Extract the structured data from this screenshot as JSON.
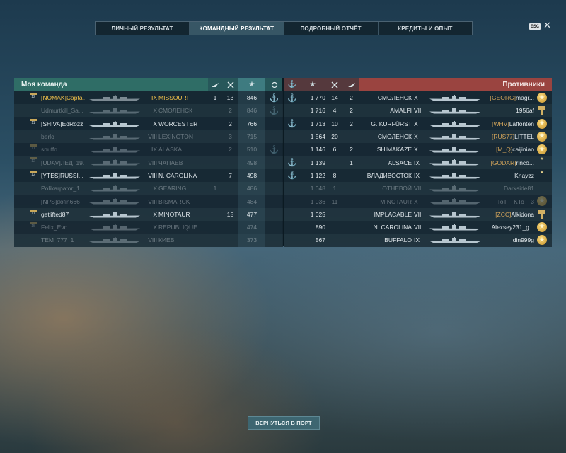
{
  "tabs": [
    {
      "label": "ЛИЧНЫЙ РЕЗУЛЬТАТ",
      "active": false
    },
    {
      "label": "КОМАНДНЫЙ РЕЗУЛЬТАТ",
      "active": true
    },
    {
      "label": "ПОДРОБНЫЙ ОТЧЁТ",
      "active": false
    },
    {
      "label": "КРЕДИТЫ И ОПЫТ",
      "active": false
    }
  ],
  "esc_key": "ESC",
  "close_glyph": "✕",
  "my_team": {
    "title": "Моя команда",
    "header_icons": [
      "planes-icon",
      "frags-icon",
      "star-icon",
      "rank-laurel-icon"
    ],
    "players": [
      {
        "rank_badge": "12",
        "clan": "[NOMAK]",
        "name": "Capta...",
        "tier": "IX",
        "ship": "MISSOURI",
        "planes": "1",
        "frags": "13",
        "xp": "846",
        "anchor": true,
        "alive": true,
        "me": true
      },
      {
        "rank_badge": "",
        "clan": "",
        "name": "Udmurtkill_Sa...",
        "tier": "X",
        "ship": "СМОЛЕНСК",
        "planes": "",
        "frags": "2",
        "xp": "846",
        "anchor": true,
        "alive": false,
        "me": false
      },
      {
        "rank_badge": "11",
        "clan": "[SHIVA]",
        "name": "EdRozz",
        "tier": "X",
        "ship": "WORCESTER",
        "planes": "",
        "frags": "2",
        "xp": "766",
        "anchor": false,
        "alive": true,
        "me": false
      },
      {
        "rank_badge": "",
        "clan": "",
        "name": "berlo",
        "tier": "VIII",
        "ship": "LEXINGTON",
        "planes": "",
        "frags": "3",
        "xp": "715",
        "anchor": false,
        "alive": false,
        "me": false
      },
      {
        "rank_badge": "11",
        "clan": "",
        "name": "snuffo",
        "tier": "IX",
        "ship": "ALASKA",
        "planes": "",
        "frags": "2",
        "xp": "510",
        "anchor": true,
        "alive": false,
        "me": false
      },
      {
        "rank_badge": "12",
        "clan": "[UDAV]",
        "name": "ЛЕД_19...",
        "tier": "VIII",
        "ship": "ЧАПАЕВ",
        "planes": "",
        "frags": "",
        "xp": "498",
        "anchor": false,
        "alive": false,
        "me": false
      },
      {
        "rank_badge": "12",
        "clan": "[YTES]",
        "name": "RUSSI...",
        "tier": "VIII",
        "ship": "N. CAROLINA",
        "planes": "",
        "frags": "7",
        "xp": "498",
        "anchor": false,
        "alive": true,
        "me": false
      },
      {
        "rank_badge": "",
        "clan": "",
        "name": "Polikarpator_1",
        "tier": "X",
        "ship": "GEARING",
        "planes": "1",
        "frags": "",
        "xp": "486",
        "anchor": false,
        "alive": false,
        "me": false
      },
      {
        "rank_badge": "",
        "clan": "[NPS]",
        "name": "dofin666",
        "tier": "VIII",
        "ship": "BISMARCK",
        "planes": "",
        "frags": "",
        "xp": "484",
        "anchor": false,
        "alive": false,
        "me": false
      },
      {
        "rank_badge": "11",
        "clan": "",
        "name": "getlifted87",
        "tier": "X",
        "ship": "MINOTAUR",
        "planes": "",
        "frags": "15",
        "xp": "477",
        "anchor": false,
        "alive": true,
        "me": false
      },
      {
        "rank_badge": "15",
        "clan": "",
        "name": "Felix_Evo",
        "tier": "X",
        "ship": "REPUBLIQUE",
        "planes": "",
        "frags": "",
        "xp": "474",
        "anchor": false,
        "alive": false,
        "me": false
      },
      {
        "rank_badge": "",
        "clan": "",
        "name": "TEM_777_1",
        "tier": "VIII",
        "ship": "КИЕВ",
        "planes": "",
        "frags": "",
        "xp": "373",
        "anchor": false,
        "alive": false,
        "me": false
      }
    ]
  },
  "enemy_team": {
    "title": "Противники",
    "header_icons": [
      "anchor-icon",
      "star-icon",
      "frags-icon",
      "planes-icon"
    ],
    "players": [
      {
        "anchor": true,
        "xp": "1 770",
        "frags": "14",
        "planes": "2",
        "ship": "СМОЛЕНСК",
        "tier": "X",
        "clan": "[GEORG]",
        "name": "magr...",
        "badge": "medal",
        "alive": true
      },
      {
        "anchor": false,
        "xp": "1 716",
        "frags": "4",
        "planes": "2",
        "ship": "AMALFI",
        "tier": "VIII",
        "clan": "",
        "name": "1956af",
        "badge": "flag",
        "alive": true
      },
      {
        "anchor": true,
        "xp": "1 713",
        "frags": "10",
        "planes": "2",
        "ship": "G. KURFÜRST",
        "tier": "X",
        "clan": "[WHV]",
        "name": "Laffonten",
        "badge": "medal",
        "alive": true
      },
      {
        "anchor": false,
        "xp": "1 564",
        "frags": "20",
        "planes": "",
        "ship": "СМОЛЕНСК",
        "tier": "X",
        "clan": "[RUS77]",
        "name": "LITTEL",
        "badge": "medal",
        "alive": true
      },
      {
        "anchor": false,
        "xp": "1 146",
        "frags": "6",
        "planes": "2",
        "ship": "SHIMAKAZE",
        "tier": "X",
        "clan": "[M_Q]",
        "name": "caijiniao",
        "badge": "medal",
        "alive": true
      },
      {
        "anchor": true,
        "xp": "1 139",
        "frags": "",
        "planes": "1",
        "ship": "ALSACE",
        "tier": "IX",
        "clan": "[GODAR]",
        "name": "rinco...",
        "badge": "star10",
        "alive": true
      },
      {
        "anchor": true,
        "xp": "1 122",
        "frags": "8",
        "planes": "",
        "ship": "ВЛАДИВОСТОК",
        "tier": "IX",
        "clan": "",
        "name": "Knayzz",
        "badge": "star10",
        "alive": true
      },
      {
        "anchor": false,
        "xp": "1 048",
        "frags": "1",
        "planes": "",
        "ship": "ОТНЕВОЙ",
        "tier": "VIII",
        "clan": "",
        "name": "Darkside81",
        "badge": "",
        "alive": false
      },
      {
        "anchor": false,
        "xp": "1 036",
        "frags": "11",
        "planes": "",
        "ship": "MINOTAUR",
        "tier": "X",
        "clan": "",
        "name": "ToT__KTo__3",
        "badge": "medal",
        "alive": false
      },
      {
        "anchor": false,
        "xp": "1 025",
        "frags": "",
        "planes": "",
        "ship": "IMPLACABLE",
        "tier": "VIII",
        "clan": "[ZCC]",
        "name": "Alkidona",
        "badge": "flag",
        "alive": true
      },
      {
        "anchor": false,
        "xp": "890",
        "frags": "",
        "planes": "",
        "ship": "N. CAROLINA",
        "tier": "VIII",
        "clan": "",
        "name": "Alexsey231_g...",
        "badge": "medal",
        "alive": true
      },
      {
        "anchor": false,
        "xp": "567",
        "frags": "",
        "planes": "",
        "ship": "BUFFALO",
        "tier": "IX",
        "clan": "",
        "name": "din999g",
        "badge": "medal",
        "alive": true
      }
    ]
  },
  "anchor_glyph": "⚓",
  "star_glyph": "★",
  "footer": {
    "return_button": "ВЕРНУТЬСЯ В ПОРТ"
  },
  "colors": {
    "ally_header": "#2f6d66",
    "enemy_header": "#9a4440",
    "highlight": "#f2c14a"
  }
}
